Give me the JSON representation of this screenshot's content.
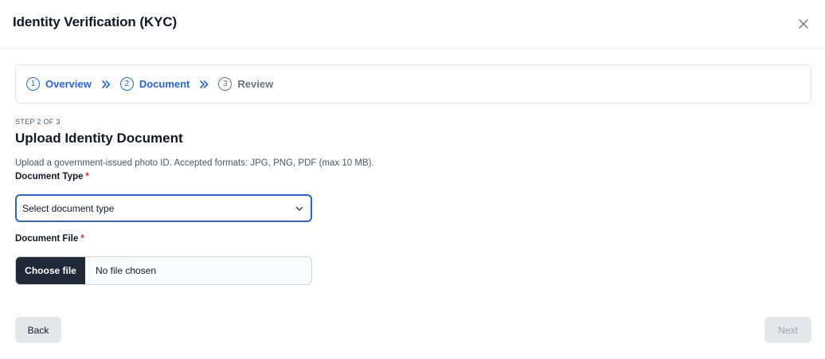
{
  "modal": {
    "title": "Identity Verification (KYC)",
    "close_icon": "close-icon"
  },
  "stepper": {
    "steps": [
      {
        "number": "1",
        "label": "Overview",
        "state": "complete"
      },
      {
        "number": "2",
        "label": "Document",
        "state": "current"
      },
      {
        "number": "3",
        "label": "Review",
        "state": "upcoming"
      }
    ],
    "separator_icon": "double-chevron-right-icon"
  },
  "section": {
    "step_count": "STEP 2 OF 3",
    "title": "Upload Identity Document",
    "description": "Upload a government-issued photo ID. Accepted formats: JPG, PNG, PDF (max 10 MB)."
  },
  "document_type": {
    "label": "Document Type",
    "required_mark": "*",
    "selected_value": "Select document type"
  },
  "document_file": {
    "label": "Document File",
    "required_mark": "*",
    "button_label": "Choose file",
    "status": "No file chosen"
  },
  "footer": {
    "back_label": "Back",
    "next_label": "Next"
  },
  "colors": {
    "accent": "#2563eb",
    "required": "#dc2626",
    "file_button_bg": "#1f2937",
    "disabled_text": "#9ca3af"
  }
}
